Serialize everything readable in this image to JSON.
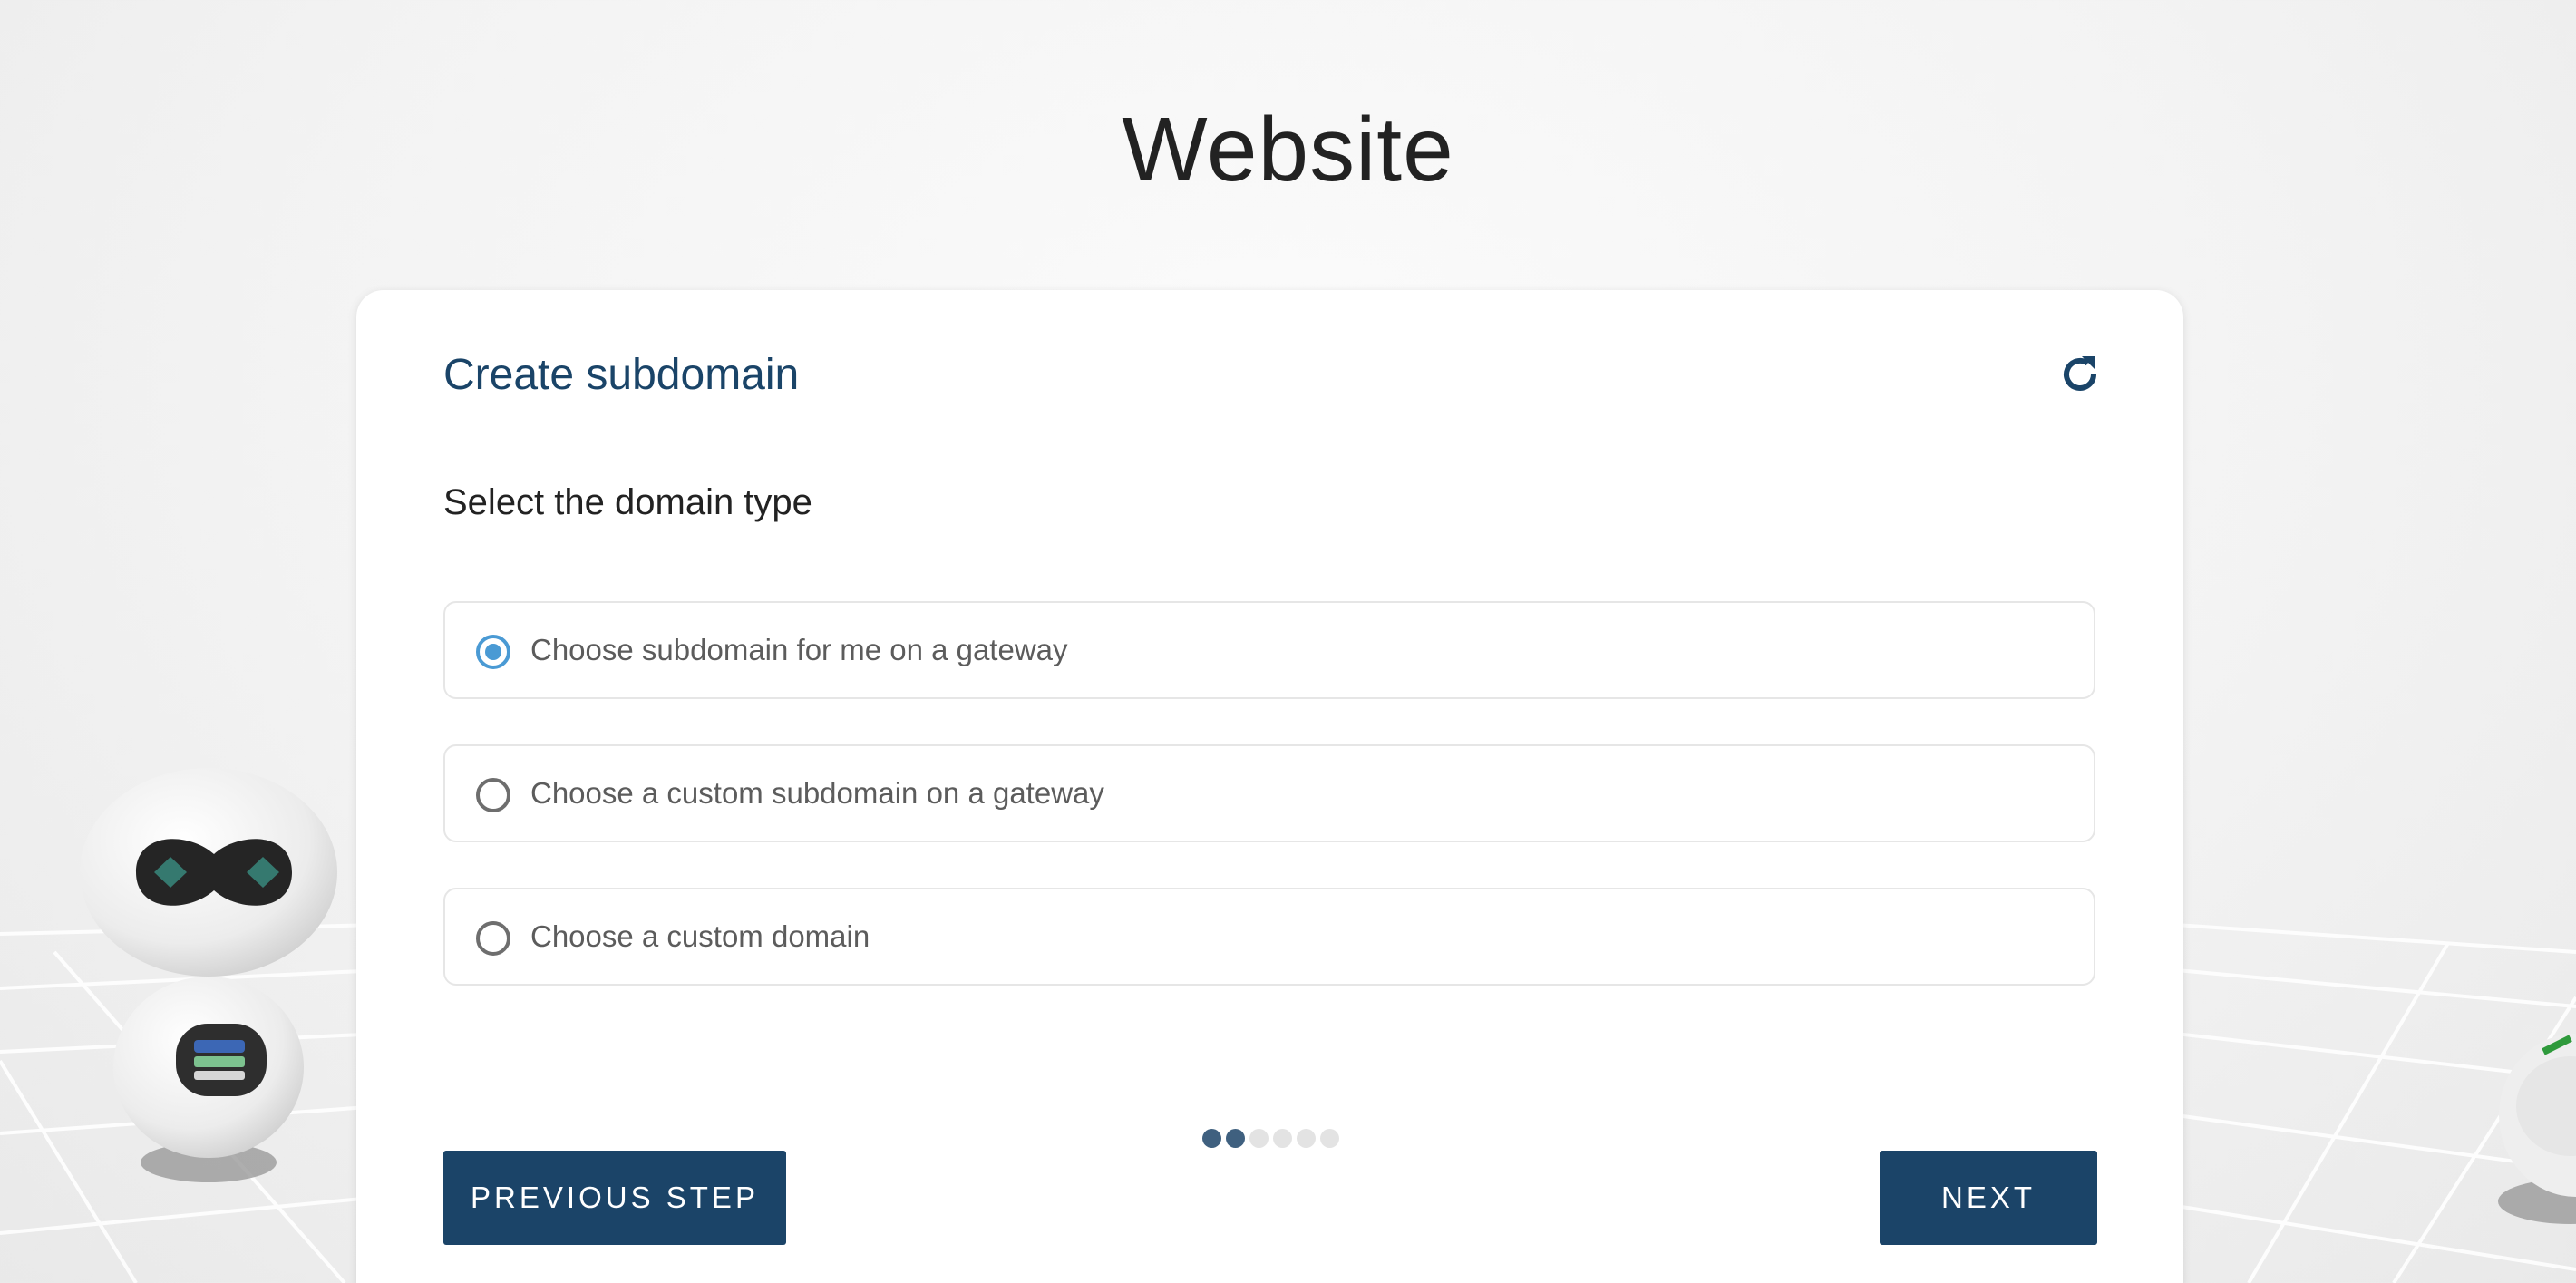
{
  "page": {
    "title": "Website"
  },
  "card": {
    "title": "Create subdomain",
    "refresh_icon": "refresh-icon",
    "subtitle": "Select the domain type",
    "options": [
      {
        "label": "Choose subdomain for me on a gateway",
        "selected": true
      },
      {
        "label": "Choose a custom subdomain on a gateway",
        "selected": false
      },
      {
        "label": "Choose a custom domain",
        "selected": false
      }
    ],
    "steps": {
      "total": 6,
      "current": 2
    },
    "prev_label": "PREVIOUS STEP",
    "next_label": "NEXT"
  },
  "colors": {
    "primary": "#1b4468",
    "title": "#1a4468",
    "radio_selected": "#4a9ad4",
    "step_active": "#3f607f",
    "step_inactive": "#e3e3e3"
  }
}
